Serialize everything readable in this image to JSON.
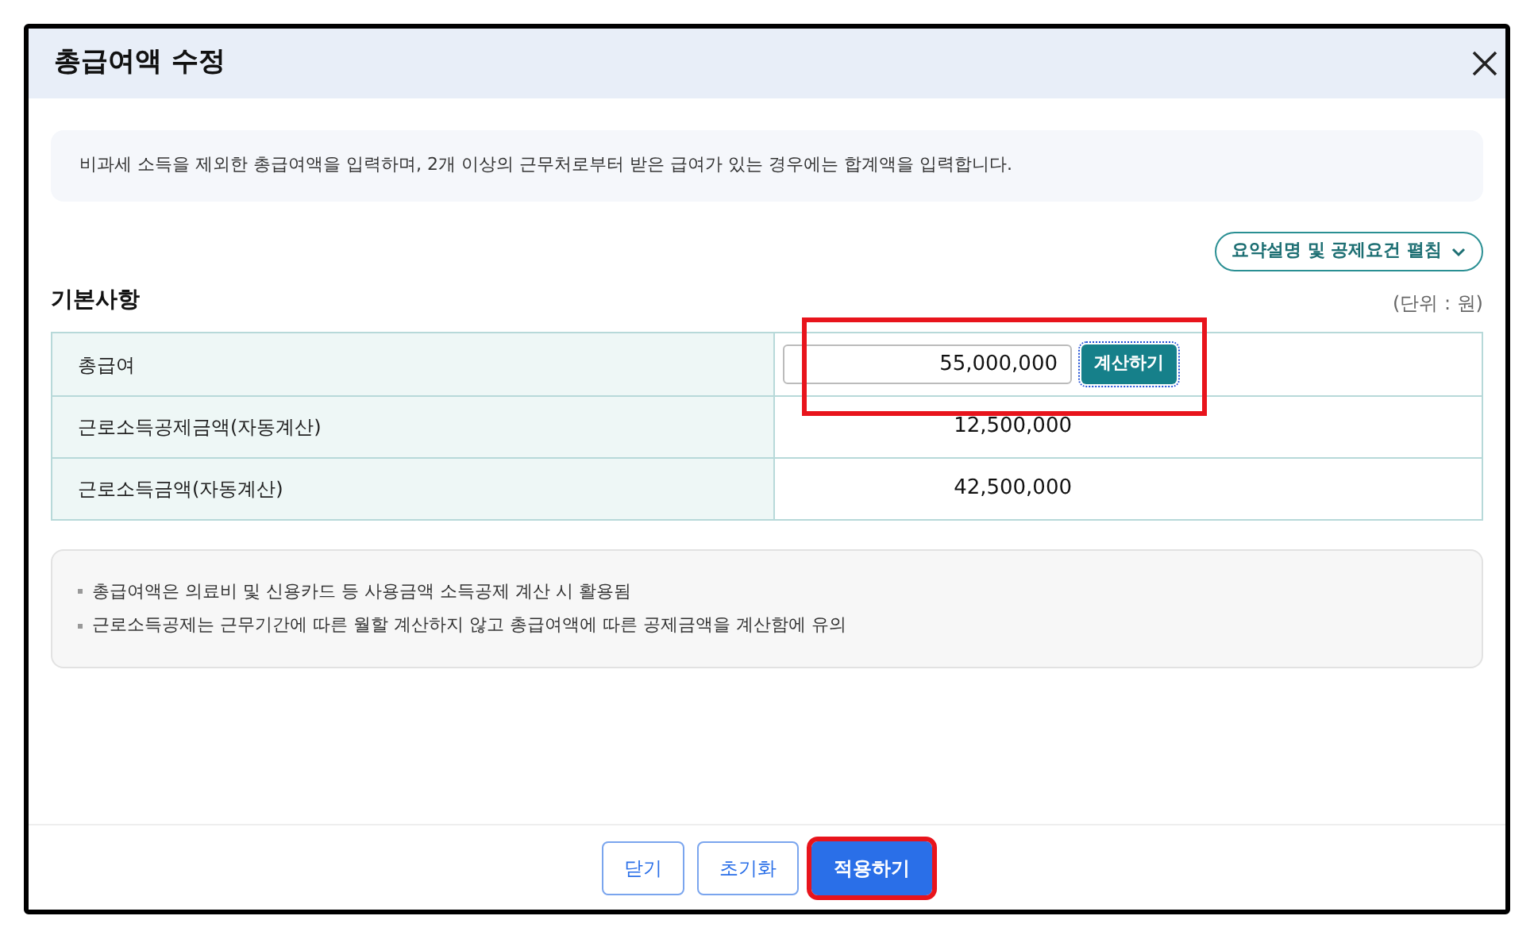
{
  "window": {
    "title": "총급여액 수정"
  },
  "info": "비과세 소득을 제외한 총급여액을 입력하며, 2개 이상의 근무처로부터 받은 급여가 있는 경우에는 합계액을 입력합니다.",
  "expand_button": {
    "label": "요약설명 및 공제요건 펼침",
    "expanded": false
  },
  "section": {
    "title": "기본사항",
    "unit": "(단위 : 원)"
  },
  "rows": [
    {
      "kind": "input",
      "label": "총급여",
      "value": "55,000,000",
      "button": "계산하기",
      "highlighted": true
    },
    {
      "kind": "text",
      "label": "근로소득공제금액(자동계산)",
      "value": "12,500,000",
      "highlighted": false
    },
    {
      "kind": "text",
      "label": "근로소득금액(자동계산)",
      "value": "42,500,000",
      "highlighted": false
    }
  ],
  "notes": [
    "총급여액은 의료비 및 신용카드 등 사용금액 소득공제 계산 시 활용됨",
    "근로소득공제는 근무기간에 따른 월할 계산하지 않고 총급여액에 따른 공제금액을 계산함에 유의"
  ],
  "buttons": [
    {
      "label": "닫기",
      "primary": false,
      "highlighted": false
    },
    {
      "label": "초기화",
      "primary": false,
      "highlighted": false
    },
    {
      "label": "적용하기",
      "primary": true,
      "highlighted": true
    }
  ]
}
